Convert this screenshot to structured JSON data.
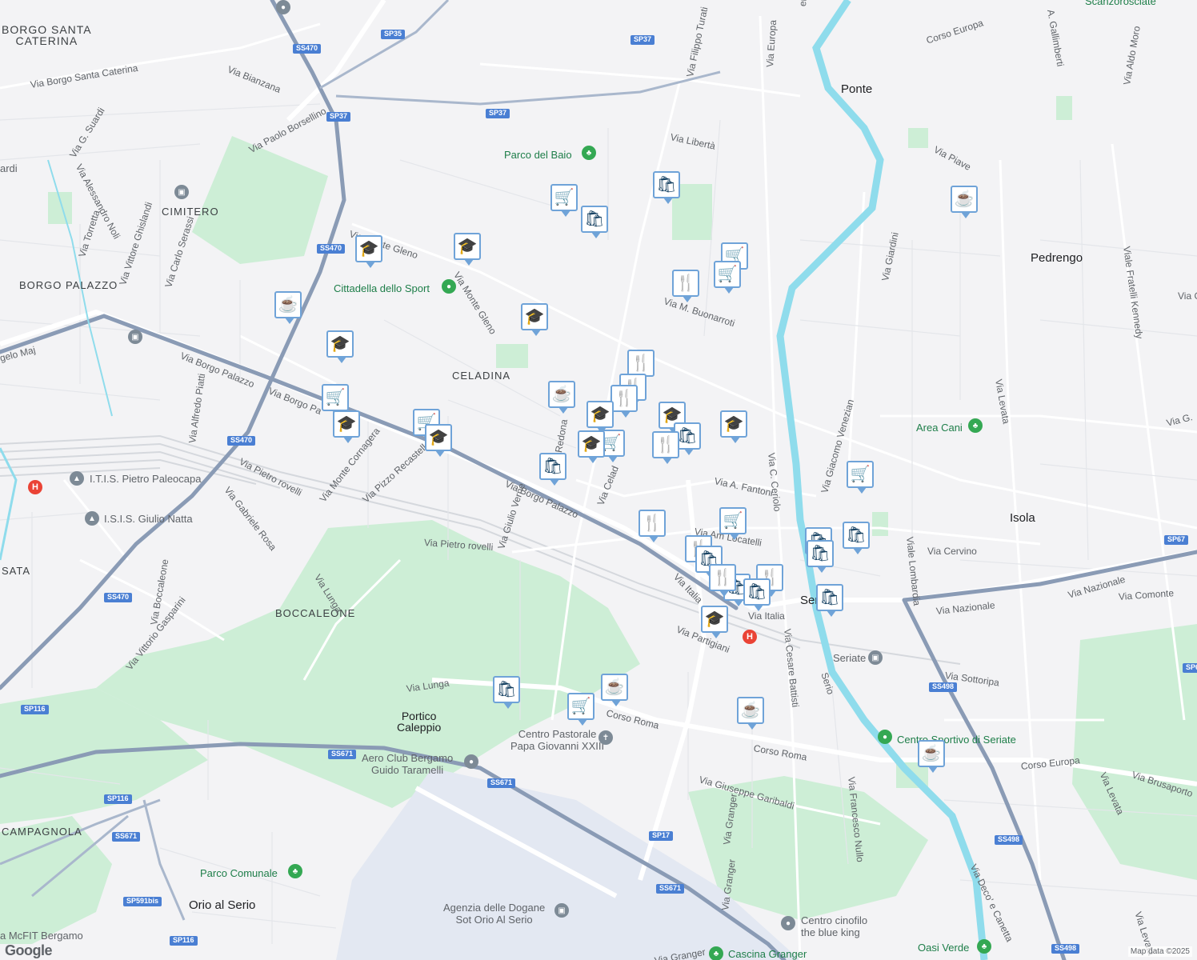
{
  "attribution": "Map data ©2025",
  "logo": "Google",
  "places": {
    "borgo_santa_caterina": "BORGO SANTA\nCATERINA",
    "cimitero": "CIMITERO",
    "borgo_palazzo": "BORGO PALAZZO",
    "celadina": "CELADINA",
    "boccaleone": "BOCCALEONE",
    "campagnola": "CAMPAGNOLA",
    "sata": "SATA",
    "ponte": "Ponte",
    "pedrengo": "Pedrengo",
    "isola": "Isola",
    "portico_caleppio": "Portico\nCaleppio",
    "orio_al_serio": "Orio al Serio",
    "seriate": "Ser"
  },
  "pois": {
    "parco_del_baio": "Parco del Baio",
    "cittadella_sport": "Cittadella dello Sport",
    "itis": "I.T.I.S. Pietro Paleocapa",
    "isis": "I.S.I.S. Giulio Natta",
    "area_cani": "Area Cani",
    "centro_pastorale": "Centro Pastorale\nPapa Giovanni XXIII",
    "aero_club": "Aero Club Bergamo\nGuido Taramelli",
    "parco_comunale": "Parco Comunale",
    "agenzia_dogane": "Agenzia delle Dogane\nSot Orio Al Serio",
    "centro_sportivo": "Centro Sportivo di Seriate",
    "centro_cinofilo": "Centro cinofilo\nthe blue king",
    "cascina_granger": "Cascina Granger",
    "oasi_verde": "Oasi Verde",
    "mcfit": "a McFIT Bergamo",
    "seriate_station": "Seriate",
    "scanzo": "Scanzorosciate",
    "ardi": "ardi"
  },
  "streets": {
    "via_borgo_santa_caterina": "Via Borgo Santa Caterina",
    "via_bianzana": "Via Bianzana",
    "via_g_suardi": "Via G. Suardi",
    "via_alessandro_noli": "Via Alessandro Noli",
    "via_torretta": "Via Torretta",
    "via_vittore_ghislandi": "Via Vittore Ghislandi",
    "via_carlo_serassi": "Via Carlo Serassi",
    "via_paolo_borsellino": "Via Paolo Borsellino",
    "via_monte_gleno": "Via Monte Gleno",
    "via_monte_gleno_2": "Via Monte Gleno",
    "via_borgo_palazzo_1": "Via Borgo Palazzo",
    "via_borgo_palazzo_2": "Via Borgo Pa",
    "via_borgo_palazzo_3": "Via Borgo Palazzo",
    "via_angelo_maj": "gelo Maj",
    "via_alfredo_piatti": "Via Alfredo Piatti",
    "via_pietro_rovelli_1": "Via Pietro rovelli",
    "via_pietro_rovelli_2": "Via Pietro rovelli",
    "via_gabriele_rosa": "Via Gabriele Rosa",
    "via_monte_cornagera": "Via Monte Cornagera",
    "via_pizzo_recastello": "Via Pizzo Recastello",
    "via_giulio_verne": "Via Giulio Verne",
    "via_redona": "o di Redona",
    "via_celadina": "Via Celad",
    "via_lunga_1": "Via Lunga",
    "via_lunga_2": "Via Lunga",
    "via_bocca_leone": "Via Boccaleone",
    "via_vittorio_gasparini": "Via Vittorio Gasparini",
    "corso_roma_1": "Corso Roma",
    "corso_roma_2": "Corso Roma",
    "via_italia_1": "Via Italia",
    "via_italia_2": "Via Italia",
    "via_partigiani": "Via Partigiani",
    "via_giuseppe_garibaldi": "Via Giuseppe Garibaldi",
    "via_granger_1": "Via Granger",
    "via_granger_2": "Via Granger",
    "via_granger_3": "Via Granger",
    "via_cesare_battisti": "Via Cesare Battisti",
    "via_francesco_nullo": "Via Francesco Nullo",
    "via_c_ceriolo": "Via C. Ceriolo",
    "via_a_fantoni": "Via A. Fantoni",
    "via_locatelli": "Via Am     Locatelli",
    "via_m_buonarroti": "Via M. Buonarroti",
    "via_liberta": "Via Libertà",
    "via_filippo_turati": "Via Filippo Turati",
    "via_europa": "Via Europa",
    "corso_europa_1": "Corso Europa",
    "corso_europa_2": "Corso Europa",
    "via_piave": "Via Piave",
    "via_giardini": "Via Giardini",
    "via_giacomo_venezian": "Via Giacomo Venezian",
    "via_levata_1": "Via Levata",
    "via_levata_2": "Via Levata",
    "via_levata_3": "Via Levata",
    "viale_fratelli_kennedy": "Viale Fratelli Kennedy",
    "via_aldo_moro": "Via Aldo Moro",
    "via_a_gallimberti": "A. Gallimberti",
    "viale_lombardia": "Viale Lombardia",
    "via_cervino": "Via Cervino",
    "via_nazionale_1": "Via Nazionale",
    "via_nazionale_2": "Via Nazionale",
    "via_comonte": "Via Comonte",
    "via_sottoripa": "Via Sottoripa",
    "via_brusaporto": "Via Brusaporto",
    "via_deco_canetta": "Via Deco' e Canetta",
    "via_g": "Via G",
    "via_g_2": "Via G.",
    "serio": "Serio",
    "mento": "ento"
  },
  "shields": {
    "sp35": "SP35",
    "sp37a": "SP37",
    "sp37b": "SP37",
    "ss470a": "SS470",
    "ss470b": "SS470",
    "ss470c": "SS470",
    "ss470d": "SS470",
    "ss671a": "SS671",
    "ss671b": "SS671",
    "ss671c": "SS671",
    "ss671d": "SS671",
    "sp116a": "SP116",
    "sp116b": "SP116",
    "sp116c": "SP116",
    "sp591bis": "SP591bis",
    "sp17": "SP17",
    "ss498a": "SS498",
    "ss498b": "SS498",
    "ss498c": "SS498",
    "sp67": "SP67",
    "sp6": "SP6"
  },
  "markers": [
    {
      "type": "cart",
      "icon": "🛒"
    },
    {
      "type": "bag",
      "icon": "🛍"
    },
    {
      "type": "bag",
      "icon": "🛍"
    },
    {
      "type": "cart",
      "icon": "🛒"
    },
    {
      "type": "cart",
      "icon": "🛒"
    },
    {
      "type": "fork",
      "icon": "🍴"
    },
    {
      "type": "school",
      "icon": "🎓"
    },
    {
      "type": "school",
      "icon": "🎓"
    },
    {
      "type": "school",
      "icon": "🎓"
    },
    {
      "type": "cafe",
      "icon": "☕"
    },
    {
      "type": "school",
      "icon": "🎓"
    },
    {
      "type": "cart",
      "icon": "🛒"
    },
    {
      "type": "school",
      "icon": "🎓"
    },
    {
      "type": "cart",
      "icon": "🛒"
    },
    {
      "type": "school",
      "icon": "🎓"
    },
    {
      "type": "cafe",
      "icon": "☕"
    },
    {
      "type": "fork",
      "icon": "🍴"
    },
    {
      "type": "fork",
      "icon": "🍴"
    },
    {
      "type": "fork",
      "icon": "🍴"
    },
    {
      "type": "school",
      "icon": "🎓"
    },
    {
      "type": "cart",
      "icon": "🛒"
    },
    {
      "type": "school",
      "icon": "🎓"
    },
    {
      "type": "school",
      "icon": "🎓"
    },
    {
      "type": "bag",
      "icon": "🛍"
    },
    {
      "type": "fork",
      "icon": "🍴"
    },
    {
      "type": "school",
      "icon": "🎓"
    },
    {
      "type": "bag",
      "icon": "🛍"
    },
    {
      "type": "cart",
      "icon": "🛒"
    },
    {
      "type": "fork",
      "icon": "🍴"
    },
    {
      "type": "cart",
      "icon": "🛒"
    },
    {
      "type": "bag",
      "icon": "🛍"
    },
    {
      "type": "bag",
      "icon": "🛍"
    },
    {
      "type": "bag",
      "icon": "🛍"
    },
    {
      "type": "fork",
      "icon": "🍴"
    },
    {
      "type": "bag",
      "icon": "🛍"
    },
    {
      "type": "bag",
      "icon": "🛍"
    },
    {
      "type": "fork",
      "icon": "🍴"
    },
    {
      "type": "fork",
      "icon": "🍴"
    },
    {
      "type": "bag",
      "icon": "🛍"
    },
    {
      "type": "school",
      "icon": "🎓"
    },
    {
      "type": "bag",
      "icon": "🛍"
    },
    {
      "type": "cafe",
      "icon": "☕"
    },
    {
      "type": "cart",
      "icon": "🛒"
    },
    {
      "type": "cafe",
      "icon": "☕"
    },
    {
      "type": "cafe",
      "icon": "☕"
    },
    {
      "type": "cafe",
      "icon": "☕"
    },
    {
      "type": "cart",
      "icon": "🛒"
    }
  ],
  "colors": {
    "marker_border": "#6fa3d8",
    "marker_icon": "#0d3a5c",
    "highway": "#8a9bb5",
    "road": "#ffffff",
    "park": "#cdeed6",
    "water": "#8fdcec",
    "airport": "#e3e8f2"
  }
}
